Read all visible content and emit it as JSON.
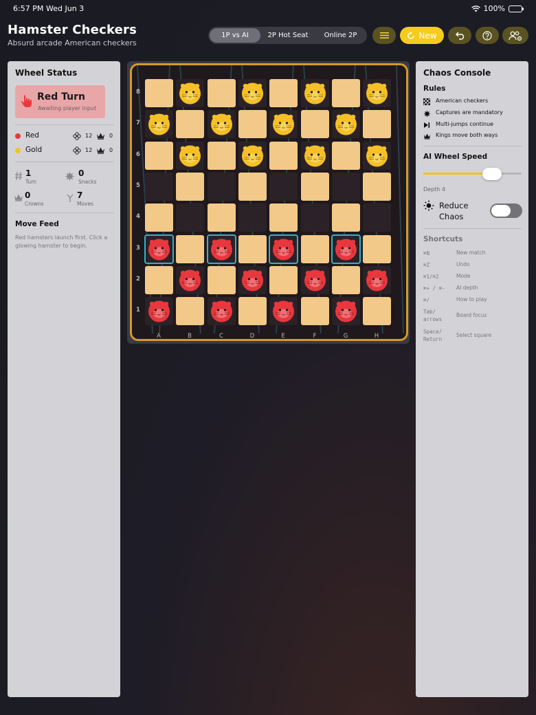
{
  "status_bar": {
    "time": "6:57 PM",
    "date": "Wed Jun 3",
    "battery": "100%"
  },
  "header": {
    "title": "Hamster Checkers",
    "subtitle": "Absurd arcade American checkers",
    "modes": [
      "1P vs AI",
      "2P Hot Seat",
      "Online 2P"
    ],
    "active_mode": "1P vs AI",
    "new_label": "New"
  },
  "wheel_status": {
    "title": "Wheel Status",
    "turn_label": "Red Turn",
    "turn_sub": "Awaiting player input",
    "players": [
      {
        "name": "Red",
        "color": "#e8383d",
        "pieces": "12",
        "crowns": "0"
      },
      {
        "name": "Gold",
        "color": "#f2c41c",
        "pieces": "12",
        "crowns": "0"
      }
    ],
    "stats": {
      "turn": {
        "value": "1",
        "label": "Turn"
      },
      "snacks": {
        "value": "0",
        "label": "Snacks"
      },
      "crowns": {
        "value": "0",
        "label": "Crowns"
      },
      "moves": {
        "value": "7",
        "label": "Moves"
      }
    },
    "feed_title": "Move Feed",
    "feed_text": "Red hamsters launch first. Click a glowing hamster to begin."
  },
  "board": {
    "files": [
      "A",
      "B",
      "C",
      "D",
      "E",
      "F",
      "G",
      "H"
    ],
    "ranks": [
      "8",
      "7",
      "6",
      "5",
      "4",
      "3",
      "2",
      "1"
    ],
    "rows": [
      "LgLgLgLg",
      "gLgLgLgL",
      "LgLgLgLg",
      "dLdLdLdL",
      "LdLdLdLd",
      "rLrLrLrL",
      "LrLrLrLr",
      "rLrLrLrL"
    ],
    "highlighted": [
      "A3",
      "C3",
      "E3",
      "G3"
    ],
    "colors": {
      "light": "#f2c988",
      "dark": "#2b2228",
      "frame": "#d49a2a",
      "highlight": "#2fb5c8"
    }
  },
  "chaos_console": {
    "title": "Chaos Console",
    "rules_title": "Rules",
    "rules": [
      {
        "icon": "checkerboard-icon",
        "text": "American checkers"
      },
      {
        "icon": "burst-icon",
        "text": "Captures are mandatory"
      },
      {
        "icon": "play-skip-icon",
        "text": "Multi-jumps continue"
      },
      {
        "icon": "crown-icon",
        "text": "Kings move both ways"
      }
    ],
    "speed_title": "AI Wheel Speed",
    "speed_level": 0.7,
    "depth_label": "Depth 4",
    "reduce_label": "Reduce Chaos",
    "reduce_on": false,
    "shortcuts_title": "Shortcuts",
    "shortcuts": [
      {
        "key": "⌘N",
        "desc": "New match"
      },
      {
        "key": "⌘Z",
        "desc": "Undo"
      },
      {
        "key": "⌘1/⌘2",
        "desc": "Mode"
      },
      {
        "key": "⌘+ / ⌘-",
        "desc": "AI depth"
      },
      {
        "key": "⌘/",
        "desc": "How to play"
      },
      {
        "key": "Tab/\narrows",
        "desc": "Board focus"
      },
      {
        "key": "Space/\nReturn",
        "desc": "Select square"
      }
    ]
  }
}
